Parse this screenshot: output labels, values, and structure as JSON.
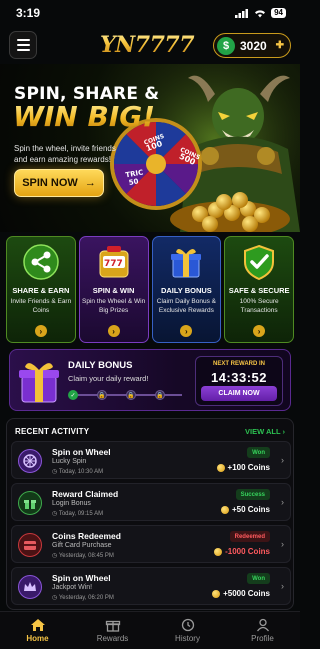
{
  "status_bar": {
    "time": "3:19",
    "battery": "94"
  },
  "header": {
    "logo": "YN7777",
    "coins": "3020",
    "currency_symbol": "$"
  },
  "hero": {
    "title_line1": "SPIN, SHARE &",
    "title_line2": "WIN BIG!",
    "subtitle": "Spin the wheel, invite friends and earn amazing rewards!",
    "button_label": "SPIN NOW",
    "wheel_labels": [
      "COINS 100",
      "COINS 500",
      "TRIC 50"
    ]
  },
  "feature_cards": [
    {
      "title": "SHARE & EARN",
      "desc": "Invite Friends & Earn Coins",
      "icon": "share-icon"
    },
    {
      "title": "SPIN & WIN",
      "desc": "Spin the Wheel & Win Big Prizes",
      "icon": "slot-machine-icon"
    },
    {
      "title": "DAILY BONUS",
      "desc": "Claim Daily Bonus & Exclusive Rewards",
      "icon": "gift-icon"
    },
    {
      "title": "SAFE & SECURE",
      "desc": "100% Secure Transactions",
      "icon": "shield-check-icon"
    }
  ],
  "daily_bonus": {
    "title": "DAILY BONUS",
    "subtitle": "Claim your daily reward!",
    "next_reward_label": "NEXT REWARD IN",
    "timer": "14:33:52",
    "claim_label": "CLAIM NOW"
  },
  "recent_activity": {
    "heading": "RECENT ACTIVITY",
    "view_all": "VIEW ALL",
    "items": [
      {
        "title": "Spin on Wheel",
        "subtitle": "Lucky Spin",
        "time": "Today, 10:30 AM",
        "badge": "Won",
        "amount": "+100 Coins",
        "icon": "wheel-icon"
      },
      {
        "title": "Reward Claimed",
        "subtitle": "Login Bonus",
        "time": "Today, 09:15 AM",
        "badge": "Success",
        "amount": "+50 Coins",
        "icon": "gift-icon"
      },
      {
        "title": "Coins Redeemed",
        "subtitle": "Gift Card Purchase",
        "time": "Yesterday, 08:45 PM",
        "badge": "Redeemed",
        "amount": "-1000 Coins",
        "icon": "gift-card-icon"
      },
      {
        "title": "Spin on Wheel",
        "subtitle": "Jackpot Win!",
        "time": "Yesterday, 06:20 PM",
        "badge": "Won",
        "amount": "+5000 Coins",
        "icon": "crown-icon"
      }
    ]
  },
  "bottom_nav": [
    {
      "label": "Home",
      "icon": "home-icon",
      "active": true
    },
    {
      "label": "Rewards",
      "icon": "gift-icon",
      "active": false
    },
    {
      "label": "History",
      "icon": "history-icon",
      "active": false
    },
    {
      "label": "Profile",
      "icon": "profile-icon",
      "active": false
    }
  ],
  "colors": {
    "gold": "#f6c445",
    "green": "#22a447",
    "purple": "#7a3cc0",
    "red": "#e03a3a"
  }
}
